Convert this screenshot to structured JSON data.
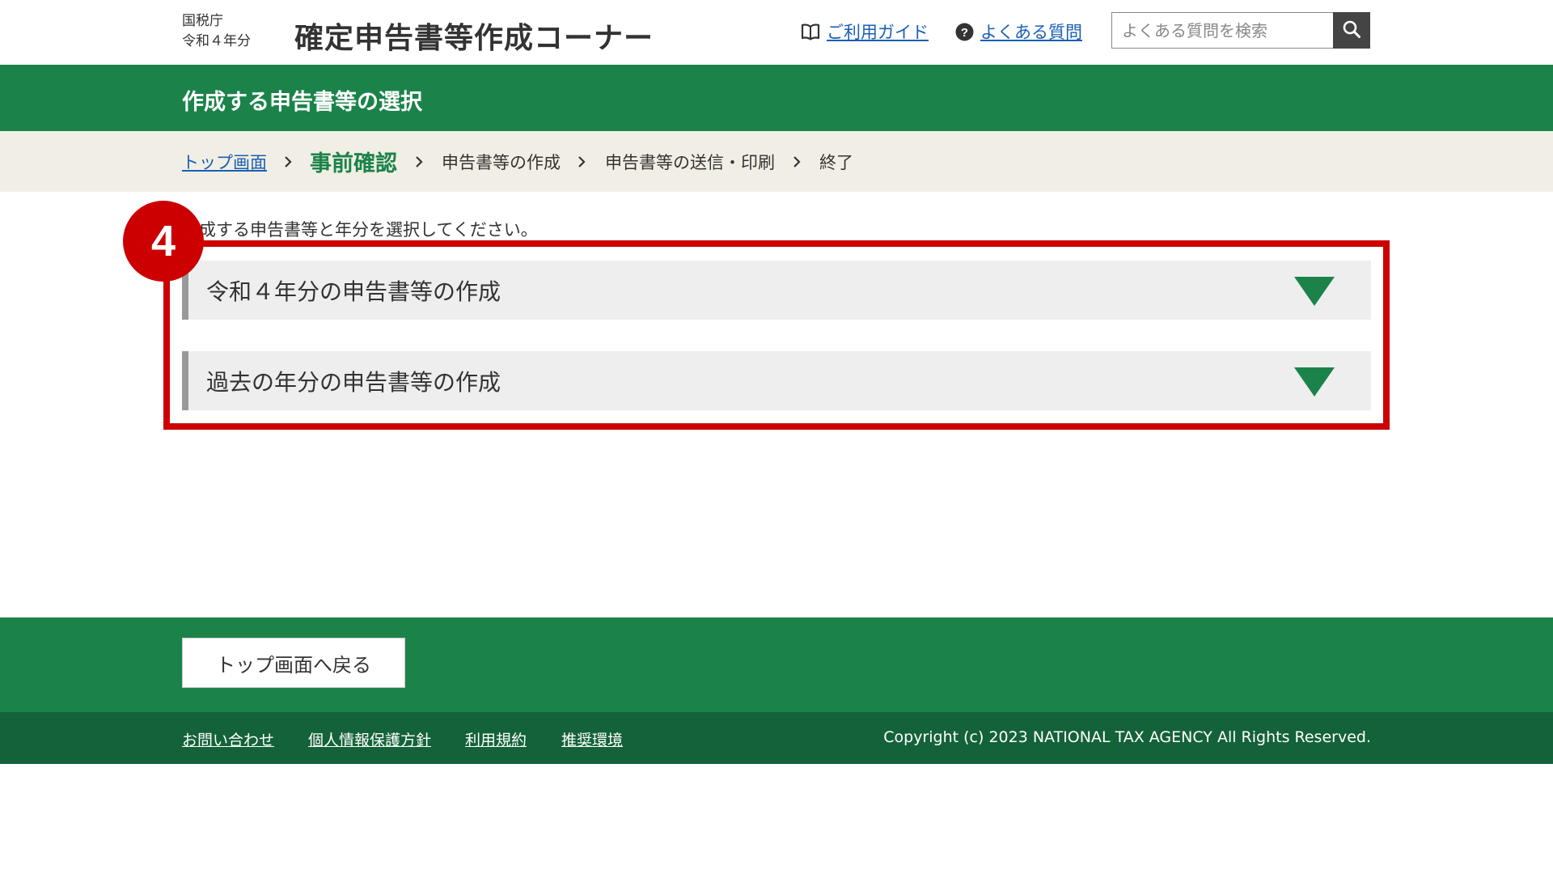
{
  "header": {
    "agency": "国税庁",
    "year": "令和４年分",
    "title": "確定申告書等作成コーナー",
    "guide_link": "ご利用ガイド",
    "faq_link": "よくある質問",
    "search_placeholder": "よくある質問を検索"
  },
  "page": {
    "heading": "作成する申告書等の選択",
    "instruction": "作成する申告書等と年分を選択してください。"
  },
  "steps": [
    {
      "label": "トップ画面"
    },
    {
      "label": "事前確認"
    },
    {
      "label": "申告書等の作成"
    },
    {
      "label": "申告書等の送信・印刷"
    },
    {
      "label": "終了"
    }
  ],
  "annotation": {
    "badge": "4",
    "color": "#cc0000"
  },
  "accordions": [
    {
      "label": "令和４年分の申告書等の作成"
    },
    {
      "label": "過去の年分の申告書等の作成"
    }
  ],
  "buttons": {
    "back_to_top": "トップ画面へ戻る"
  },
  "footer": {
    "links": [
      "お問い合わせ",
      "個人情報保護方針",
      "利用規約",
      "推奨環境"
    ],
    "copyright": "Copyright (c) 2023 NATIONAL TAX AGENCY All Rights Reserved."
  },
  "colors": {
    "brand_green": "#1b834a",
    "dark_green": "#146239",
    "step_bar": "#f1efe5",
    "link_blue": "#1a5fb4"
  },
  "icons": {
    "guide": "book-icon",
    "faq": "question-circle-icon",
    "search": "search-icon",
    "step_separator": "chevron-right-icon",
    "accordion": "triangle-down-icon"
  }
}
